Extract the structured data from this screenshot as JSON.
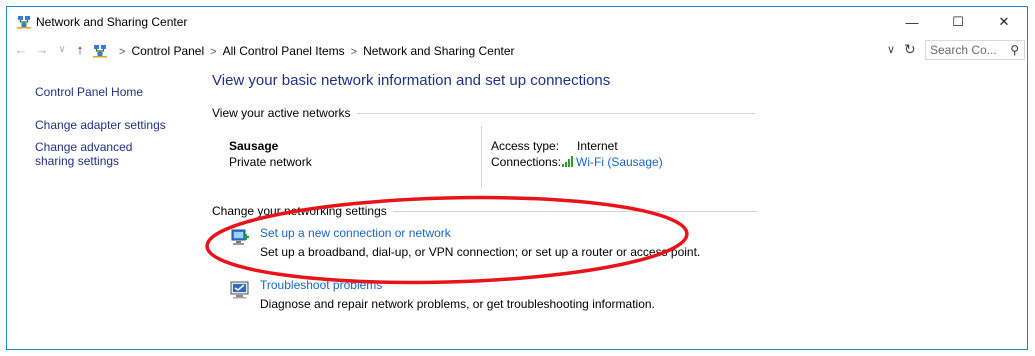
{
  "window": {
    "title": "Network and Sharing Center",
    "minimize_glyph": "—",
    "maximize_glyph": "☐",
    "close_glyph": "✕"
  },
  "address_bar": {
    "back_glyph": "←",
    "forward_glyph": "→",
    "recent_glyph": "∨",
    "up_glyph": "↑",
    "breadcrumbs": [
      "Control Panel",
      "All Control Panel Items",
      "Network and Sharing Center"
    ],
    "separator": ">",
    "dropdown_glyph": "∨",
    "refresh_glyph": "↻",
    "search_placeholder": "Search Co...",
    "search_glyph": "⚲"
  },
  "sidebar": {
    "home": "Control Panel Home",
    "adapter": "Change adapter settings",
    "advanced": "Change advanced sharing settings"
  },
  "main": {
    "title": "View your basic network information and set up connections",
    "active_networks_label": "View your active networks",
    "network": {
      "name": "Sausage",
      "category": "Private network",
      "access_type_label": "Access type:",
      "access_type_value": "Internet",
      "connections_label": "Connections:",
      "connection_link": "Wi-Fi (Sausage)"
    },
    "change_settings_label": "Change your networking settings",
    "tasks": [
      {
        "icon": "new-connection-icon",
        "link": "Set up a new connection or network",
        "description": "Set up a broadband, dial-up, or VPN connection; or set up a router or access point."
      },
      {
        "icon": "troubleshoot-icon",
        "link": "Troubleshoot problems",
        "description": "Diagnose and repair network problems, or get troubleshooting information."
      }
    ]
  },
  "colors": {
    "link": "#1a66c1",
    "heading": "#1e3287",
    "annotation": "#e8141a",
    "window_border": "#1e83d6"
  }
}
